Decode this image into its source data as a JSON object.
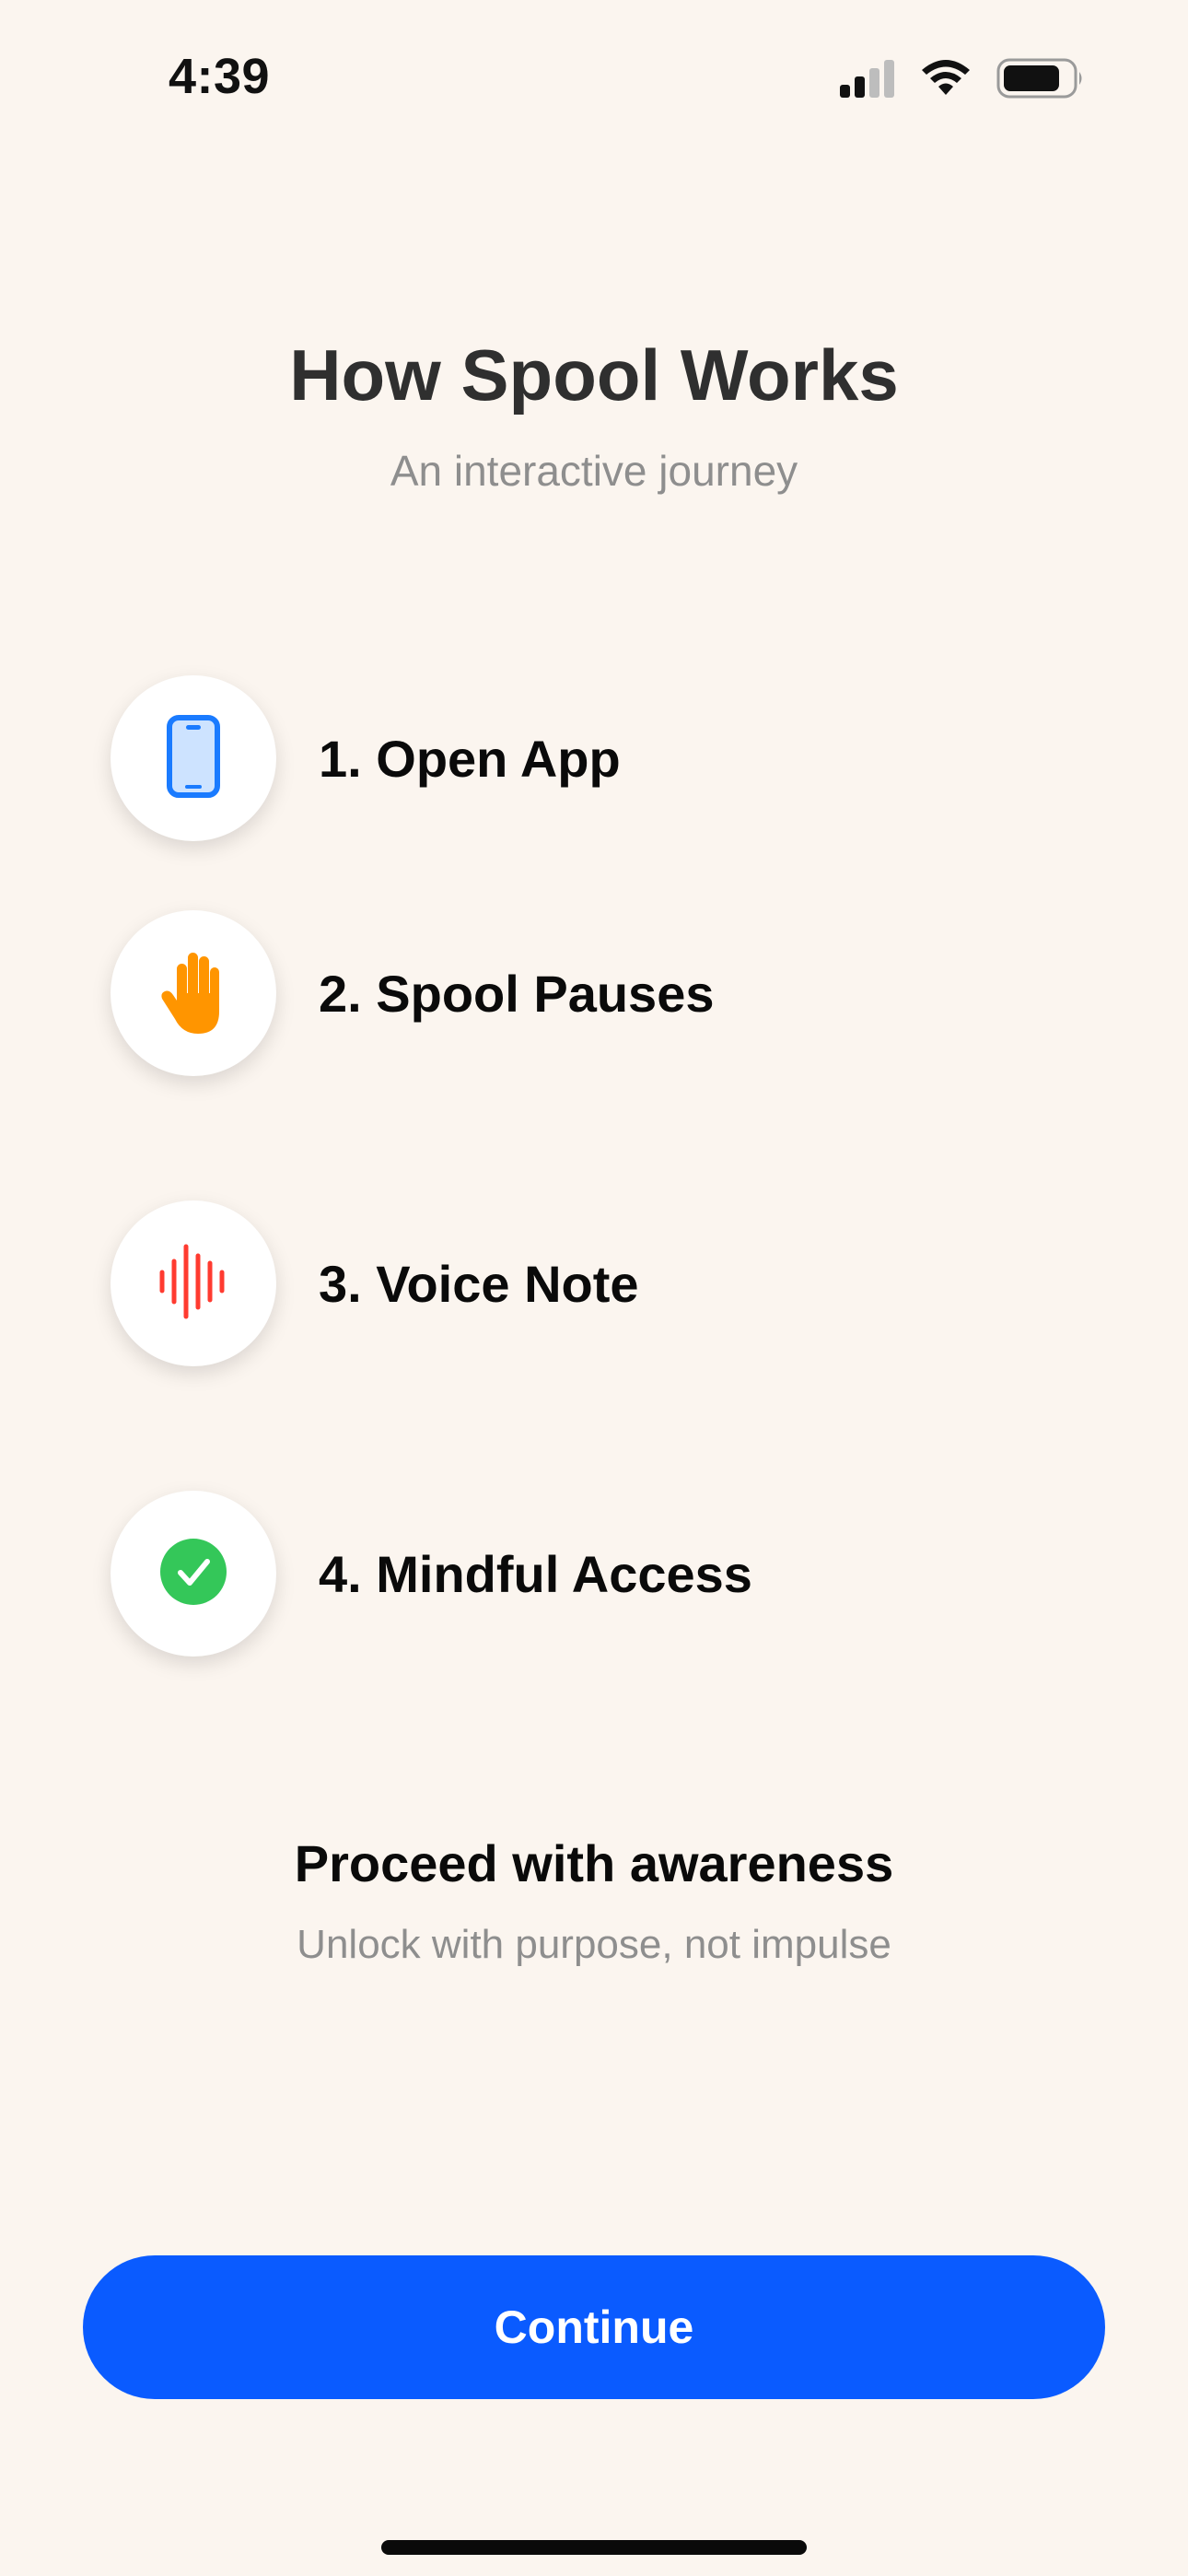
{
  "status_bar": {
    "time": "4:39",
    "icons": [
      "cellular-signal-icon",
      "wifi-icon",
      "battery-icon"
    ]
  },
  "header": {
    "title": "How Spool Works",
    "subtitle": "An interactive journey"
  },
  "steps": [
    {
      "label": "1. Open App",
      "icon": "phone-icon",
      "color": "#1A7BFF"
    },
    {
      "label": "2. Spool Pauses",
      "icon": "hand-icon",
      "color": "#FF9500"
    },
    {
      "label": "3. Voice Note",
      "icon": "waveform-icon",
      "color": "#FF3B30"
    },
    {
      "label": "4. Mindful Access",
      "icon": "checkmark-circle-icon",
      "color": "#34C759"
    }
  ],
  "footer": {
    "title": "Proceed with awareness",
    "subtitle": "Unlock with purpose, not impulse"
  },
  "continue_button": {
    "label": "Continue",
    "color": "#0A5BFF"
  },
  "colors": {
    "background": "#FBF5EF",
    "title": "#2F2F2F",
    "muted_text": "#8E8E8E"
  }
}
